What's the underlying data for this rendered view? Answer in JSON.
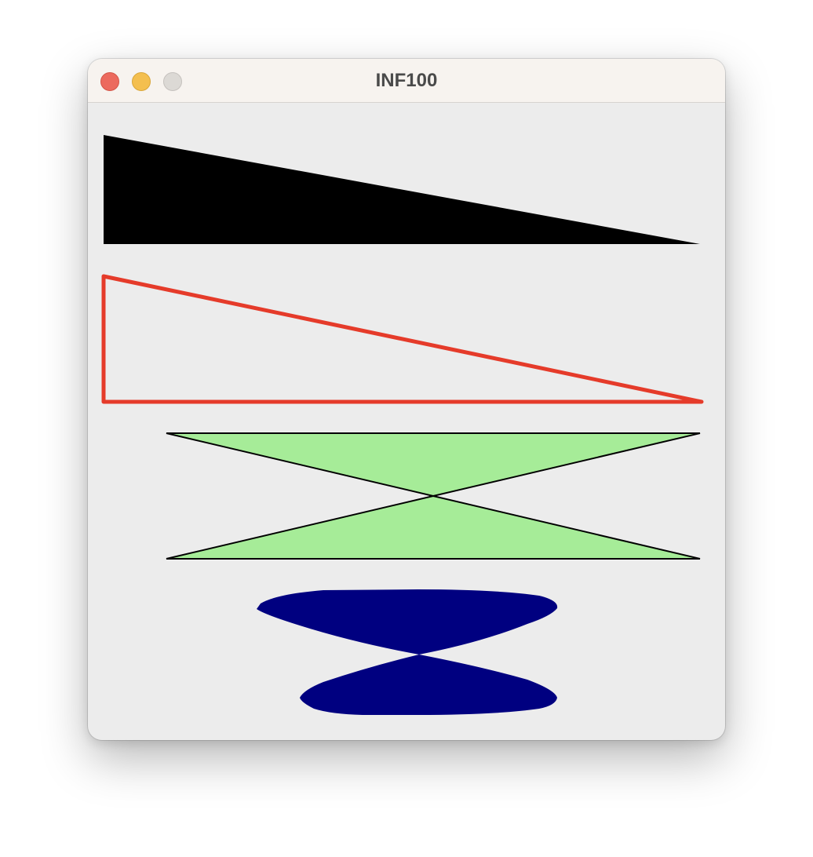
{
  "window": {
    "title": "INF100",
    "buttons": {
      "close": "close",
      "minimize": "minimize",
      "zoom": "zoom"
    }
  },
  "canvas": {
    "background": "#ececec",
    "shapes": [
      {
        "name": "filled-black-triangle",
        "kind": "filled-polygon",
        "fill": "#000000"
      },
      {
        "name": "red-outline-triangle",
        "kind": "outline-polygon",
        "stroke": "#e53b2a"
      },
      {
        "name": "green-hourglass",
        "kind": "filled-polygon-outlined",
        "fill": "#a6ec98",
        "stroke": "#000000"
      },
      {
        "name": "navy-bowtie",
        "kind": "filled-polygon",
        "fill": "#000080"
      }
    ]
  }
}
